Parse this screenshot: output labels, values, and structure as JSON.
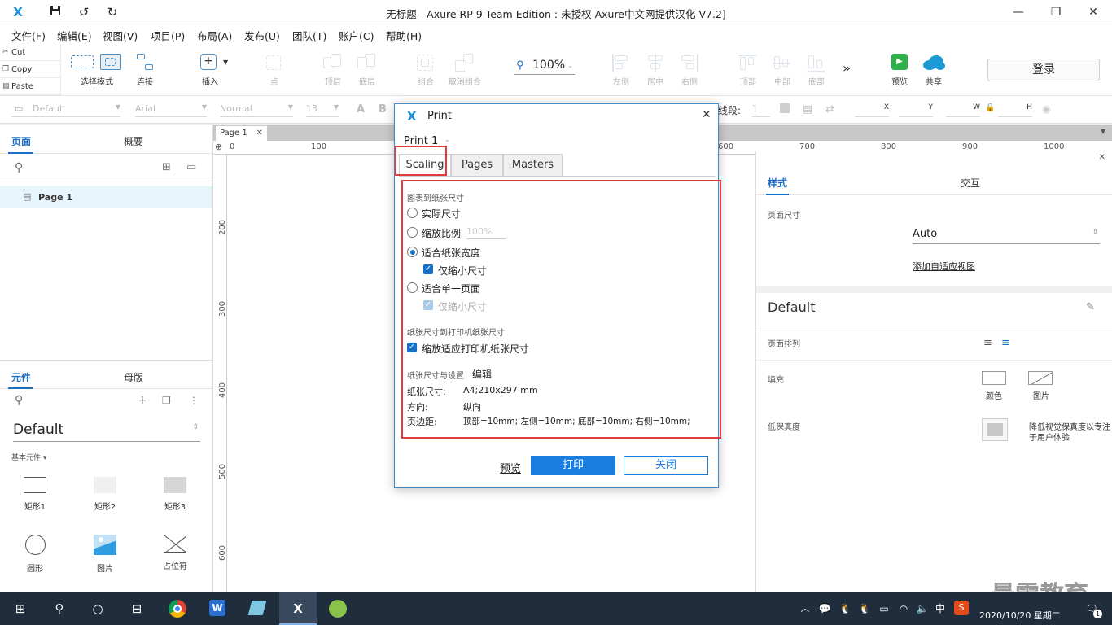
{
  "window": {
    "title": "无标题 - Axure RP 9 Team Edition : 未授权     Axure中文网提供汉化 V7.2]"
  },
  "menu": [
    "文件(F)",
    "编辑(E)",
    "视图(V)",
    "项目(P)",
    "布局(A)",
    "发布(U)",
    "团队(T)",
    "账户(C)",
    "帮助(H)"
  ],
  "clipboard": {
    "cut": "Cut",
    "copy": "Copy",
    "paste": "Paste"
  },
  "toolbar": {
    "select_mode": "选择模式",
    "connect": "连接",
    "insert": "插入",
    "point": "点",
    "top_layer": "顶层",
    "bottom_layer": "底层",
    "group": "组合",
    "ungroup": "取消组合",
    "zoom": "100%",
    "align_left": "左侧",
    "align_center": "居中",
    "align_right": "右侧",
    "align_top": "顶部",
    "align_middle": "中部",
    "align_bottom": "底部",
    "preview": "预览",
    "share": "共享",
    "login": "登录"
  },
  "stylebar": {
    "style": "Default",
    "font": "Arial",
    "weight": "Normal",
    "size": "13",
    "line_label": "线段:",
    "line_value": "1",
    "x": "X",
    "y": "Y",
    "w": "W",
    "h": "H"
  },
  "pages_panel": {
    "tab_pages": "页面",
    "tab_outline": "概要",
    "page_item": "Page 1"
  },
  "widgets_panel": {
    "tab_widgets": "元件",
    "tab_masters": "母版",
    "library": "Default",
    "category": "基本元件 ▾",
    "items": [
      "矩形1",
      "矩形2",
      "矩形3",
      "圆形",
      "图片",
      "占位符"
    ]
  },
  "canvas": {
    "page_tab": "Page 1",
    "hruler": [
      "0",
      "100",
      "600",
      "700",
      "800",
      "900",
      "1000"
    ],
    "vruler": [
      "200",
      "300",
      "400",
      "500",
      "600"
    ]
  },
  "right_panel": {
    "tab_style": "样式",
    "tab_interaction": "交互",
    "page_size_label": "页面尺寸",
    "page_size_value": "Auto",
    "adaptive_link": "添加自适应视图",
    "default_style": "Default",
    "page_align_label": "页面排列",
    "fill_label": "填充",
    "fill_color": "颜色",
    "fill_image": "图片",
    "low_fidelity_label": "低保真度",
    "low_fidelity_desc1": "降低视觉保真度以专注",
    "low_fidelity_desc2": "于用户体验"
  },
  "watermark": "最需教育",
  "dialog": {
    "title": "Print",
    "print_name": "Print 1",
    "tabs": [
      "Scaling",
      "Pages",
      "Masters"
    ],
    "section_diagram": "图表到纸张尺寸",
    "opt_actual": "实际尺寸",
    "opt_scale": "缩放比例",
    "scale_value": "100%",
    "opt_fit_width": "适合纸张宽度",
    "opt_shrink_only": "仅缩小尺寸",
    "opt_fit_page": "适合单一页面",
    "opt_shrink_only_2": "仅缩小尺寸",
    "section_paper": "纸张尺寸到打印机纸张尺寸",
    "opt_fit_printer": "缩放适应打印机纸张尺寸",
    "section_settings": "纸张尺寸与设置",
    "edit_link": "编辑",
    "paper_size_label": "纸张尺寸:",
    "paper_size_value": "A4;210x297 mm",
    "orientation_label": "方向:",
    "orientation_value": "纵向",
    "margin_label": "页边距:",
    "margin_value": "顶部=10mm; 左侧=10mm; 底部=10mm; 右侧=10mm;",
    "btn_preview": "预览",
    "btn_print": "打印",
    "btn_close": "关闭"
  },
  "taskbar": {
    "ime": "中",
    "date": "2020/10/20 星期二",
    "notifications": "1"
  }
}
